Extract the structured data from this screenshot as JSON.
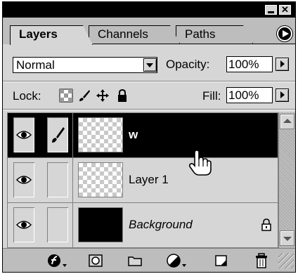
{
  "window": {
    "minimize_glyph": "",
    "close_glyph": "✕"
  },
  "tabs": [
    {
      "label": "Layers",
      "active": true
    },
    {
      "label": "Channels",
      "active": false
    },
    {
      "label": "Paths",
      "active": false
    }
  ],
  "blend": {
    "mode": "Normal",
    "opacity_label": "Opacity:",
    "opacity_value": "100%"
  },
  "lock": {
    "label": "Lock:",
    "icons": [
      "lock-transparent-pixels-icon",
      "lock-image-pixels-icon",
      "lock-position-icon",
      "lock-all-icon"
    ],
    "fill_label": "Fill:",
    "fill_value": "100%"
  },
  "layers": [
    {
      "name": "w",
      "selected": true,
      "visible": true,
      "linked_brush": true,
      "thumbnail": "transparent"
    },
    {
      "name": "Layer 1",
      "selected": false,
      "visible": true,
      "linked_brush": false,
      "thumbnail": "transparent"
    },
    {
      "name": "Background",
      "selected": false,
      "visible": true,
      "linked_brush": false,
      "thumbnail": "black",
      "locked": true
    }
  ],
  "bottom_icons": [
    "layer-style-icon",
    "add-mask-icon",
    "new-set-icon",
    "adjustment-layer-icon",
    "new-layer-icon",
    "trash-icon"
  ],
  "colors": {
    "panel": "#d6d6d6",
    "selected_row": "#000000",
    "titlebar": "#000000"
  }
}
